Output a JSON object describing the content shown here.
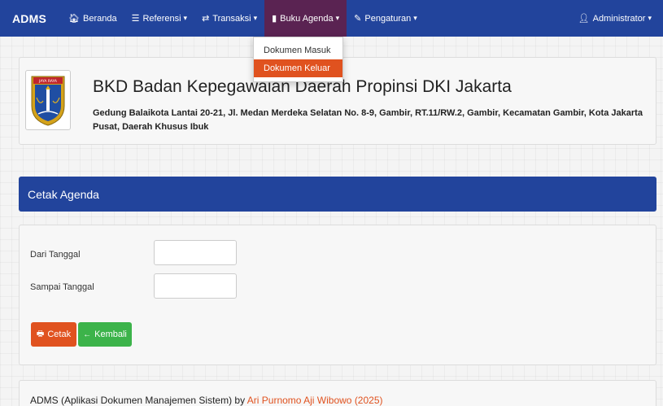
{
  "navbar": {
    "brand": "ADMS",
    "items": [
      {
        "icon": "home-icon",
        "glyph": "🏠︎",
        "label": "Beranda",
        "caret": ""
      },
      {
        "icon": "list-icon",
        "glyph": "☰",
        "label": "Referensi",
        "caret": "▾"
      },
      {
        "icon": "shuffle-icon",
        "glyph": "⇄",
        "label": "Transaksi",
        "caret": "▾"
      },
      {
        "icon": "book-icon",
        "glyph": "▮",
        "label": "Buku Agenda",
        "caret": "▾"
      },
      {
        "icon": "wrench-icon",
        "glyph": "✎",
        "label": "Pengaturan",
        "caret": "▾"
      }
    ],
    "user": {
      "icon": "user-icon",
      "glyph": "👤︎",
      "label": "Administrator",
      "caret": "▾"
    }
  },
  "dropdown": {
    "items": [
      "Dokumen Masuk",
      "Dokumen Keluar"
    ],
    "highlighted_index": 1
  },
  "header": {
    "logo_text": "JAYA RAYA",
    "title": "BKD Badan Kepegawaian Daerah Propinsi DKI Jakarta",
    "address": "Gedung Balaikota Lantai 20-21, Jl. Medan Merdeka Selatan No. 8-9, Gambir, RT.11/RW.2, Gambir, Kecamatan Gambir, Kota Jakarta Pusat, Daerah Khusus Ibuk"
  },
  "section": {
    "title": "Cetak Agenda"
  },
  "form": {
    "from_label": "Dari Tanggal",
    "from_value": "",
    "to_label": "Sampai Tanggal",
    "to_value": "",
    "print_button": "Cetak",
    "back_button": "Kembali"
  },
  "footer": {
    "text": "ADMS (Aplikasi Dokumen Manajemen Sistem) by ",
    "link": "Ari Purnomo Aji Wibowo (2025)"
  },
  "colors": {
    "navbar": "#22449c",
    "active_nav": "#5a2352",
    "accent_orange": "#e0521f",
    "accent_green": "#3cb34a"
  }
}
